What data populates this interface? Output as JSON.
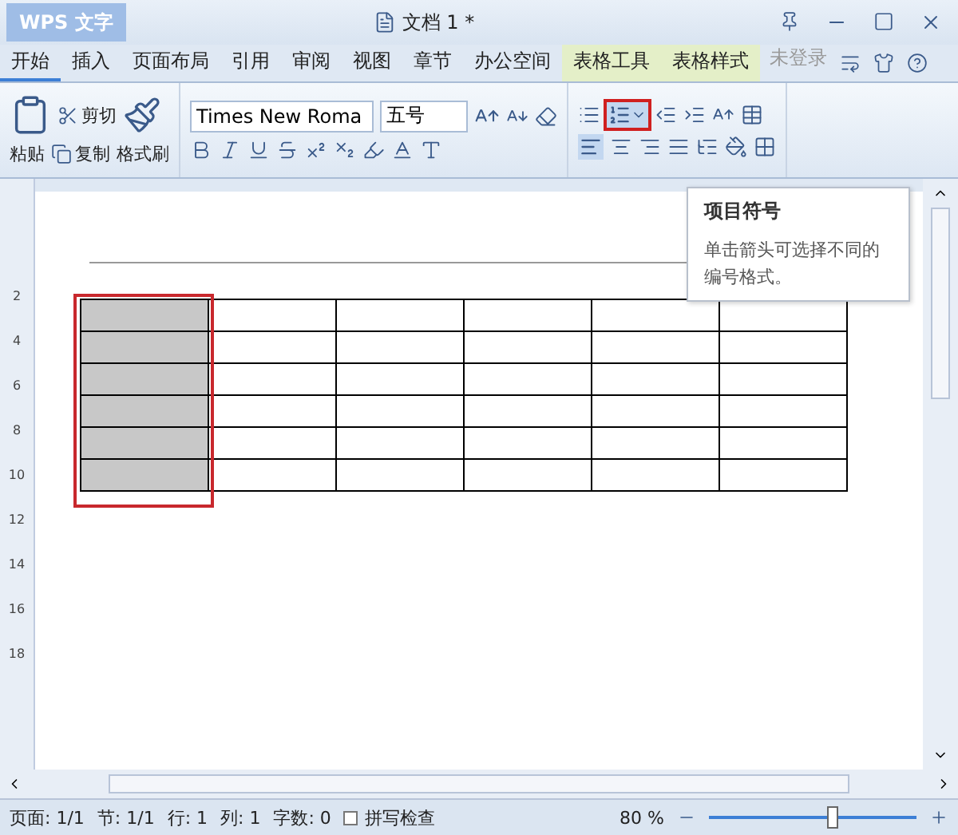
{
  "title_bar": {
    "app_name": "WPS 文字",
    "document_title": "文档 1 *"
  },
  "tabs": [
    {
      "label": "开始",
      "selected": true,
      "kind": "normal"
    },
    {
      "label": "插入",
      "selected": false,
      "kind": "normal"
    },
    {
      "label": "页面布局",
      "selected": false,
      "kind": "normal"
    },
    {
      "label": "引用",
      "selected": false,
      "kind": "normal"
    },
    {
      "label": "审阅",
      "selected": false,
      "kind": "normal"
    },
    {
      "label": "视图",
      "selected": false,
      "kind": "normal"
    },
    {
      "label": "章节",
      "selected": false,
      "kind": "normal"
    },
    {
      "label": "办公空间",
      "selected": false,
      "kind": "normal"
    },
    {
      "label": "表格工具",
      "selected": false,
      "kind": "contextual"
    },
    {
      "label": "表格样式",
      "selected": false,
      "kind": "contextual"
    }
  ],
  "account": {
    "label": "未登录"
  },
  "ribbon": {
    "paste": "粘贴",
    "cut": "剪切",
    "copy": "复制",
    "format_painter": "格式刷",
    "font_name": "Times New Roma",
    "font_size": "五号",
    "numbering_button": {
      "selected": true
    },
    "align_left_button": {
      "selected": true
    }
  },
  "tooltip": {
    "title": "项目符号",
    "body": "单击箭头可选择不同的编号格式。"
  },
  "ruler": {
    "labels": [
      "2",
      "4",
      "6",
      "8",
      "10",
      "12",
      "14",
      "16",
      "18"
    ]
  },
  "table": {
    "rows": [
      {
        "cells": [
          {
            "selected": true
          },
          {
            "selected": false
          },
          {
            "selected": false
          },
          {
            "selected": false
          },
          {
            "selected": false
          },
          {
            "selected": false
          }
        ]
      },
      {
        "cells": [
          {
            "selected": true
          },
          {
            "selected": false
          },
          {
            "selected": false
          },
          {
            "selected": false
          },
          {
            "selected": false
          },
          {
            "selected": false
          }
        ]
      },
      {
        "cells": [
          {
            "selected": true
          },
          {
            "selected": false
          },
          {
            "selected": false
          },
          {
            "selected": false
          },
          {
            "selected": false
          },
          {
            "selected": false
          }
        ]
      },
      {
        "cells": [
          {
            "selected": true
          },
          {
            "selected": false
          },
          {
            "selected": false
          },
          {
            "selected": false
          },
          {
            "selected": false
          },
          {
            "selected": false
          }
        ]
      },
      {
        "cells": [
          {
            "selected": true
          },
          {
            "selected": false
          },
          {
            "selected": false
          },
          {
            "selected": false
          },
          {
            "selected": false
          },
          {
            "selected": false
          }
        ]
      },
      {
        "cells": [
          {
            "selected": true
          },
          {
            "selected": false
          },
          {
            "selected": false
          },
          {
            "selected": false
          },
          {
            "selected": false
          },
          {
            "selected": false
          }
        ]
      }
    ]
  },
  "status_bar": {
    "items": [
      "页面: 1/1",
      "节: 1/1",
      "行: 1",
      "列: 1",
      "字数: 0"
    ],
    "spell_check": {
      "label": "拼写检查",
      "checked": false
    },
    "zoom": {
      "reading": "80 %",
      "level": 0.6
    }
  }
}
